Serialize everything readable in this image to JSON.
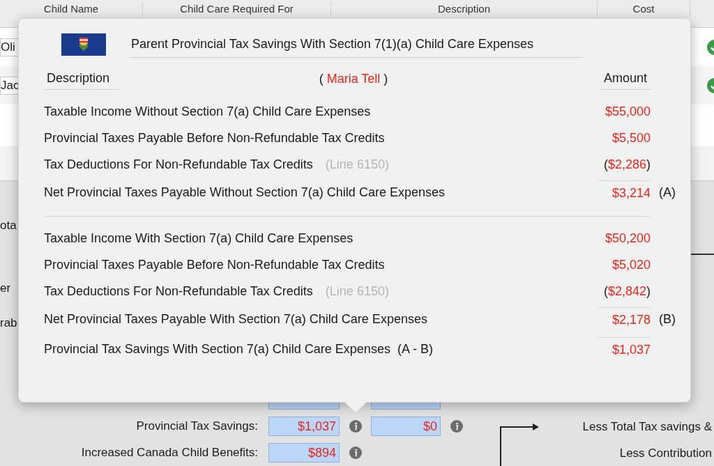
{
  "table": {
    "columns": [
      "Child Name",
      "Child Care Required For",
      "Description",
      "Cost"
    ],
    "rows": [
      {
        "child_name": "Oli",
        "checked": true
      },
      {
        "child_name": "Jac",
        "checked": true
      }
    ]
  },
  "side_labels": [
    "ota",
    "er",
    "rab"
  ],
  "savings": [
    {
      "label": "Provincial Tax Savings:",
      "values": [
        "$1,037",
        "$0"
      ]
    },
    {
      "label": "Increased Canada Child Benefits:",
      "values": [
        "$894"
      ]
    }
  ],
  "right_labels": [
    "Less Total Tax savings &",
    "Less Contribution"
  ],
  "popover": {
    "title": "Parent Provincial Tax Savings With Section 7(1)(a) Child Care Expenses",
    "header": {
      "description": "Description",
      "open": "(",
      "person": "Maria Tell",
      "close": ")",
      "amount": "Amount"
    },
    "sections": [
      [
        {
          "label": "Taxable Income Without Section 7(a) Child Care Expenses",
          "amount": "$55,000"
        },
        {
          "label": "Provincial Taxes Payable Before Non-Refundable Tax Credits",
          "amount": "$5,500"
        },
        {
          "label": "Tax Deductions For Non-Refundable Tax Credits",
          "note": "(Line 6150)",
          "open": "(",
          "amount": "$2,286",
          "close": ")"
        },
        {
          "label": "Net Provincial Taxes Payable Without Section 7(a) Child Care Expenses",
          "amount": "$3,214",
          "suffix": "(A)",
          "rule": true
        }
      ],
      [
        {
          "label": "Taxable Income With Section 7(a) Child Care Expenses",
          "amount": "$50,200"
        },
        {
          "label": "Provincial Taxes Payable Before Non-Refundable Tax Credits",
          "amount": "$5,020"
        },
        {
          "label": "Tax Deductions For Non-Refundable Tax Credits",
          "note": "(Line 6150)",
          "open": "(",
          "amount": "$2,842",
          "close": ")"
        },
        {
          "label": "Net Provincial Taxes Payable With Section 7(a) Child Care Expenses",
          "amount": "$2,178",
          "suffix": "(B)",
          "rule": true
        },
        {
          "label": "Provincial Tax Savings With Section 7(a) Child Care Expenses  (A - B)",
          "amount": "$1,037",
          "rule": true
        }
      ]
    ]
  }
}
